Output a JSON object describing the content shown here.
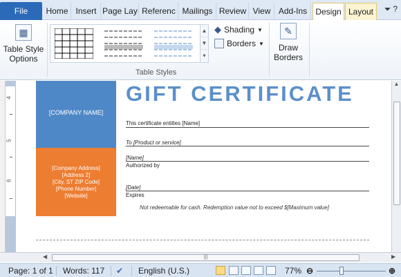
{
  "tabs": {
    "file": "File",
    "items": [
      "Home",
      "Insert",
      "Page Lay",
      "Referenc",
      "Mailings",
      "Review",
      "View",
      "Add-Ins"
    ],
    "context": [
      "Design",
      "Layout"
    ],
    "active": "Design"
  },
  "ribbon": {
    "table_style_options": "Table Style Options",
    "shading": "Shading",
    "borders": "Borders",
    "draw_borders": "Draw Borders",
    "group_table_styles": "Table Styles"
  },
  "certificate": {
    "title": "GIFT CERTIFICATE",
    "company_name": "[COMPANY NAME]",
    "address_lines": [
      "[Company Address]",
      "[Address 2]",
      "[City, ST ZIP Code]",
      "[Phone Number]",
      "[Website]"
    ],
    "entitles": "This certificate entitles [Name]",
    "to_product": "To [Product or service]",
    "authorized_value": "[Name]",
    "authorized_label": "Authorized by",
    "expires_value": "[Date]",
    "expires_label": "Expires",
    "disclaimer": "Not redeemable for cash. Redemption value not to exceed $[Maximum value]"
  },
  "status": {
    "page": "Page: 1 of 1",
    "words": "Words: 117",
    "language": "English (U.S.)",
    "zoom": "77%"
  },
  "colors": {
    "accent_blue": "#4f88c7",
    "accent_orange": "#ed7d31",
    "title_blue": "#5b8fcb",
    "file_tab": "#2a6ab8"
  }
}
